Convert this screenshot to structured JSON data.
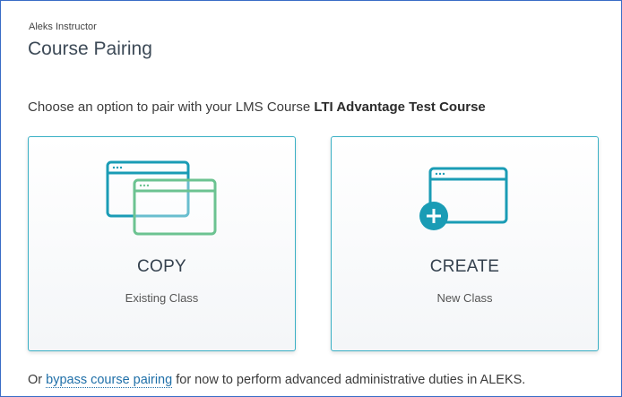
{
  "header": {
    "role": "Aleks Instructor",
    "title": "Course Pairing"
  },
  "prompt": {
    "text": "Choose an option to pair with your LMS Course",
    "course_name": "LTI Advantage Test Course"
  },
  "options": {
    "copy": {
      "label": "COPY",
      "sublabel": "Existing Class",
      "icon": "copy-windows-icon"
    },
    "create": {
      "label": "CREATE",
      "sublabel": "New Class",
      "icon": "new-window-plus-icon"
    }
  },
  "footer": {
    "prefix": "Or",
    "link": "bypass course pairing",
    "suffix": "for now to perform advanced administrative duties in ALEKS."
  },
  "colors": {
    "frame": "#3a6cc6",
    "card_border": "#3ab0c5",
    "icon_teal": "#1a9cb5",
    "icon_green": "#6cc391",
    "link": "#1f6fa8"
  }
}
